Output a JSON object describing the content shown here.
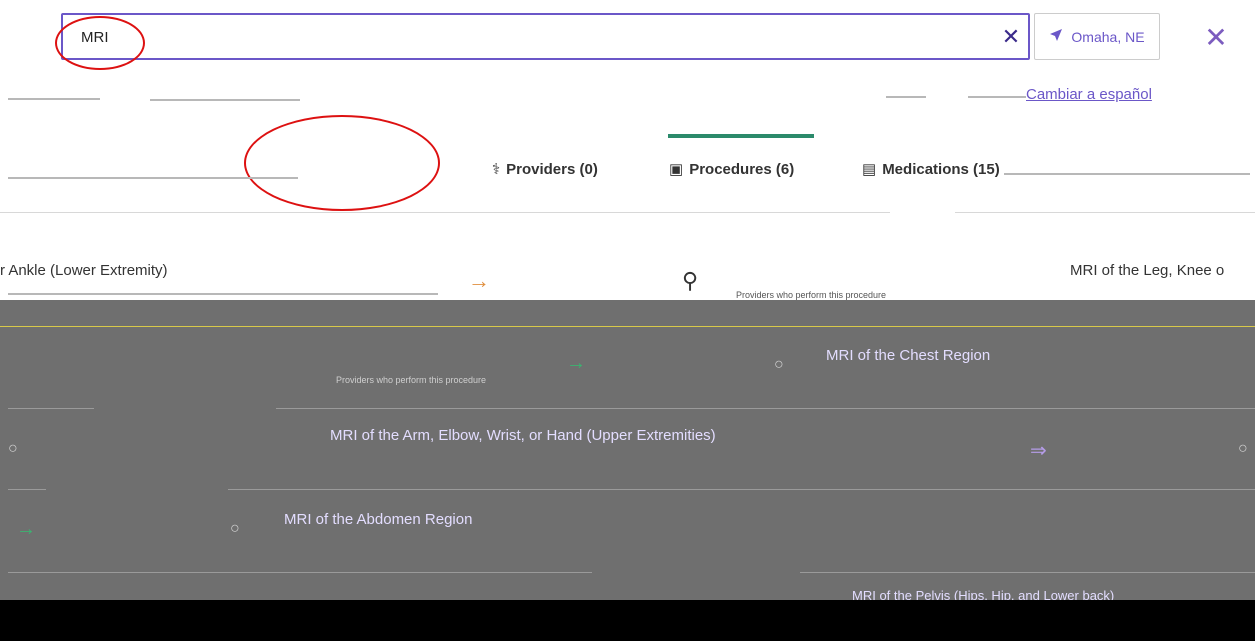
{
  "search": {
    "value": "MRI",
    "clear_icon": "✕",
    "location_label": "Omaha, NE",
    "location_icon": "navigation-arrow-icon",
    "close_icon": "✕"
  },
  "lang": {
    "link_text": "Cambiar a español"
  },
  "tabs": [
    {
      "label": "Providers (0)",
      "icon": "stethoscope-icon"
    },
    {
      "label": "Procedures (6)",
      "icon": "briefcase-medical-icon"
    },
    {
      "label": "Medications (15)",
      "icon": "pill-bottle-icon"
    }
  ],
  "results": {
    "top_partial_left": "r Ankle (Lower Extremity)",
    "top_partial_right": "MRI of the Leg, Knee o",
    "top_sub": "Providers who perform this procedure",
    "items": [
      {
        "title": "MRI of the Chest Region"
      },
      {
        "title": "MRI of the Arm, Elbow, Wrist, or Hand (Upper Extremities)"
      },
      {
        "title": "MRI of the Abdomen Region"
      },
      {
        "title": "MRI of the Pelvis (Hips, Hip, and Lower back)"
      }
    ],
    "providers_hint": "Providers who perform this procedure"
  },
  "colors": {
    "accent": "#6b57c8",
    "tab_active": "#2b8a6b",
    "panel": "#6f6f6f",
    "annotation": "#dd1111"
  }
}
